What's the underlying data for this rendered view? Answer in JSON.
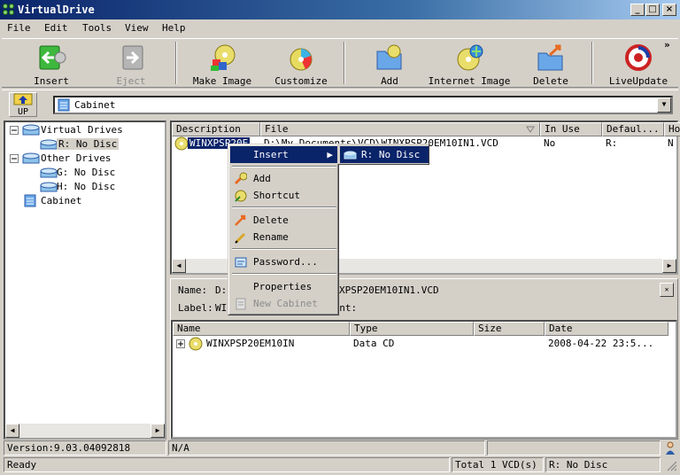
{
  "window": {
    "title": "VirtualDrive"
  },
  "menubar": {
    "items": [
      {
        "label": "File"
      },
      {
        "label": "Edit"
      },
      {
        "label": "Tools"
      },
      {
        "label": "View"
      },
      {
        "label": "Help"
      }
    ]
  },
  "toolbar": {
    "insert": "Insert",
    "eject": "Eject",
    "make_image": "Make Image",
    "customize": "Customize",
    "add": "Add",
    "internet_image": "Internet Image",
    "delete": "Delete",
    "liveupdate": "LiveUpdate",
    "overflow": "»"
  },
  "address": {
    "up_label": "UP",
    "value": "Cabinet"
  },
  "tree": {
    "virtual_drives": "Virtual Drives",
    "r_drive": "R:  No Disc",
    "other_drives": "Other Drives",
    "g_drive": "G:  No Disc",
    "h_drive": "H:  No Disc",
    "cabinet": "Cabinet"
  },
  "filelist": {
    "headers": {
      "description": "Description",
      "file": "File",
      "in_use": "In Use",
      "default": "Defaul...",
      "h": "Ho"
    },
    "row": {
      "description": "WINXPSP20E",
      "file": "D:\\My Documents\\VCD\\WINXPSP20EM10IN1.VCD",
      "in_use": "No",
      "default": "R:",
      "h": "N"
    }
  },
  "details": {
    "name_label": "Name:",
    "name_value": "D:\\",
    "name_tail": "XPSP20EM10IN1.VCD",
    "label_label": "Label:",
    "label_value": "WIN",
    "label_tail": "ment:",
    "headers": {
      "name": "Name",
      "type": "Type",
      "size": "Size",
      "date": "Date"
    },
    "row": {
      "name": "WINXPSP20EM10IN",
      "type": "Data CD",
      "size": "",
      "date": "2008-04-22 23:5..."
    }
  },
  "context_menu": {
    "insert": "Insert",
    "add": "Add",
    "shortcut": "Shortcut",
    "delete": "Delete",
    "rename": "Rename",
    "password": "Password...",
    "properties": "Properties",
    "new_cabinet": "New Cabinet"
  },
  "submenu": {
    "item": "R:  No Disc"
  },
  "status": {
    "version": "Version:9.03.04092818",
    "na": "N/A",
    "ready": "Ready",
    "total": "Total 1 VCD(s)",
    "drive": "R:  No Disc"
  },
  "colors": {
    "titlebar": "#0a246a",
    "highlight": "#0a246a",
    "face": "#d4d0c8"
  }
}
